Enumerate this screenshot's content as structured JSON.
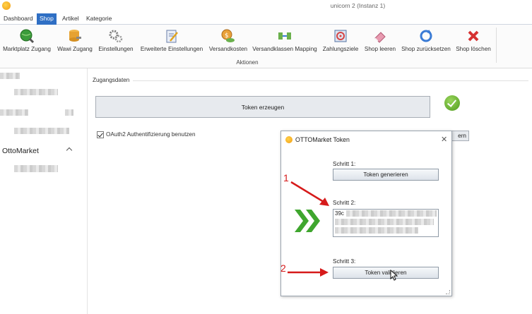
{
  "window": {
    "title": "unicorn 2 (Instanz 1)"
  },
  "tabs": [
    "Dashboard",
    "Shop",
    "Artikel",
    "Kategorie"
  ],
  "ribbon": {
    "buttons": [
      {
        "label": "Marktplatz Zugang",
        "icon": "globe-search-icon"
      },
      {
        "label": "Wawi Zugang",
        "icon": "database-key-icon"
      },
      {
        "label": "Einstellungen",
        "icon": "gears-icon"
      },
      {
        "label": "Erweiterte Einstellungen",
        "icon": "clipboard-pencil-icon"
      },
      {
        "label": "Versandkosten",
        "icon": "money-coins-icon"
      },
      {
        "label": "Versandklassen Mapping",
        "icon": "mapping-arrows-icon"
      },
      {
        "label": "Zahlungsziele",
        "icon": "target-calendar-icon"
      },
      {
        "label": "Shop leeren",
        "icon": "eraser-icon"
      },
      {
        "label": "Shop zurücksetzen",
        "icon": "reset-refresh-icon"
      },
      {
        "label": "Shop löschen",
        "icon": "red-x-icon"
      }
    ],
    "group_label": "Aktionen"
  },
  "sidebar": {
    "section_title": "OttoMarket"
  },
  "main": {
    "group_title": "Zugangsdaten",
    "token_button": "Token erzeugen",
    "oauth_label": "OAuth2 Authentifizierung benutzen",
    "partial_button": "ern"
  },
  "dialog": {
    "title": "OTTOMarket Token",
    "close": "✕",
    "step1_label": "Schritt 1:",
    "step1_button": "Token generieren",
    "step2_label": "Schritt 2:",
    "token_value_prefix": "39c",
    "step3_label": "Schritt 3:",
    "step3_button": "Token validieren"
  },
  "annotations": {
    "one": "1",
    "two": "2"
  },
  "colors": {
    "accent": "#2f6fc4",
    "annotation": "#d61a1a",
    "ok": "#4f9a1e"
  }
}
